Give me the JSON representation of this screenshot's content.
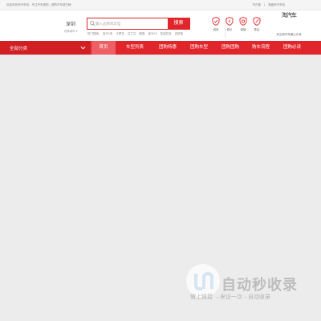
{
  "topbar": {
    "welcome": "欢迎来到淘汽车网，专注汽车团购，团购汽车超万辆",
    "links": [
      "车巴客",
      "收藏淘汽车网"
    ]
  },
  "city": {
    "name": "深圳",
    "switch": "切换城市 ▾"
  },
  "search": {
    "placeholder": "输入品牌或车型",
    "button": "搜索",
    "hot_label": "热门搜索:",
    "hot_items": [
      "宝马1系",
      "卡罗拉",
      "汉兰达",
      "朗逸",
      "宝马X3",
      "凯迪拉克",
      "迈锐宝"
    ]
  },
  "services": [
    {
      "label": "诚信",
      "icon": "shield-check-icon"
    },
    {
      "label": "低价",
      "icon": "price-icon"
    },
    {
      "label": "保值",
      "icon": "shield-icon"
    },
    {
      "label": "售后",
      "icon": "wrench-icon"
    }
  ],
  "qr": {
    "image_text": "淘汽车",
    "caption": "关注淘汽车微公众号"
  },
  "nav": {
    "category": "全部分类",
    "items": [
      "首页",
      "车型列表",
      "团购特惠",
      "团购车型",
      "团购团购",
      "购车流程",
      "团购必读"
    ]
  },
  "watermark": {
    "title": "自动秒收录",
    "subtitle": "做上链接 →来访一次→自动收录"
  },
  "colors": {
    "brand": "#e0262b",
    "nav_active": "#ee5f63",
    "background": "#ececec"
  }
}
